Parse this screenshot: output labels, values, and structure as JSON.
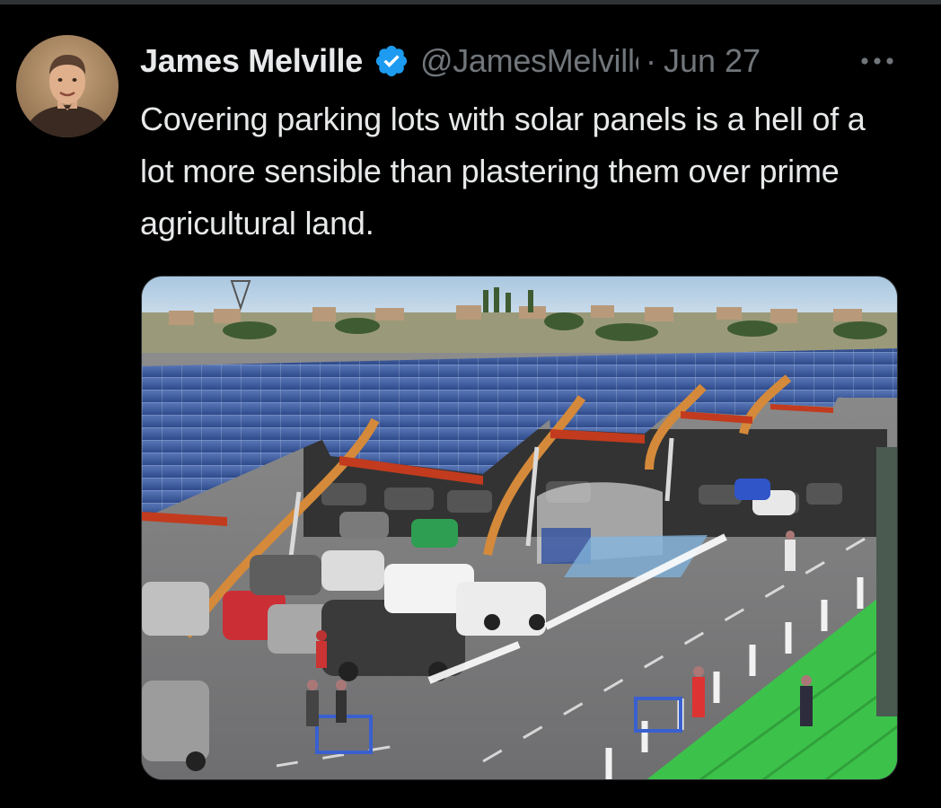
{
  "tweet": {
    "author": {
      "display_name": "James Melville",
      "handle": "@JamesMelville",
      "verified": true,
      "avatar_icon": "user-avatar-photo"
    },
    "separator": "·",
    "date": "Jun 27",
    "more_icon": "more-horizontal-icon",
    "text": "Covering parking lots with solar panels is a hell of a lot more sensible than plastering them over prime agricultural land.",
    "media_image": "solar-carport-parking-lot-photo"
  },
  "colors": {
    "background": "#000000",
    "primary_text": "#e7e9ea",
    "secondary_text": "#71767b",
    "verified_badge": "#1d9bf0",
    "divider": "#2f3336"
  }
}
